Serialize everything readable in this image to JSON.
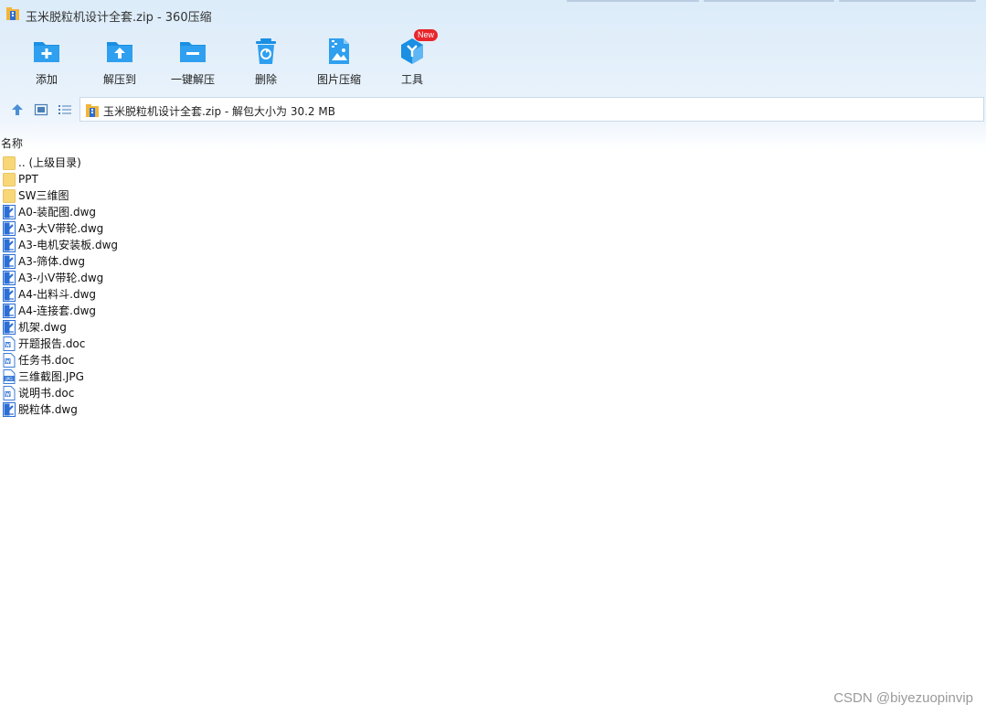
{
  "window": {
    "title": "玉米脱粒机设计全套.zip - 360压缩"
  },
  "toolbar": {
    "items": [
      {
        "label": "添加",
        "icon": "add-icon"
      },
      {
        "label": "解压到",
        "icon": "extract-to-icon"
      },
      {
        "label": "一键解压",
        "icon": "one-click-extract-icon"
      },
      {
        "label": "删除",
        "icon": "delete-icon"
      },
      {
        "label": "图片压缩",
        "icon": "image-compress-icon"
      },
      {
        "label": "工具",
        "icon": "tools-icon",
        "badge": "New"
      }
    ]
  },
  "address": {
    "text": "玉米脱粒机设计全套.zip - 解包大小为 30.2 MB"
  },
  "columns": {
    "name": "名称"
  },
  "files": [
    {
      "name": ".. (上级目录)",
      "type": "folder"
    },
    {
      "name": "PPT",
      "type": "folder"
    },
    {
      "name": "SW三维图",
      "type": "folder"
    },
    {
      "name": "A0-装配图.dwg",
      "type": "dwg"
    },
    {
      "name": "A3-大V带轮.dwg",
      "type": "dwg"
    },
    {
      "name": "A3-电机安装板.dwg",
      "type": "dwg"
    },
    {
      "name": "A3-筛体.dwg",
      "type": "dwg"
    },
    {
      "name": "A3-小V带轮.dwg",
      "type": "dwg"
    },
    {
      "name": "A4-出料斗.dwg",
      "type": "dwg"
    },
    {
      "name": "A4-连接套.dwg",
      "type": "dwg"
    },
    {
      "name": "机架.dwg",
      "type": "dwg"
    },
    {
      "name": "开题报告.doc",
      "type": "doc"
    },
    {
      "name": "任务书.doc",
      "type": "doc"
    },
    {
      "name": "三维截图.JPG",
      "type": "jpg"
    },
    {
      "name": "说明书.doc",
      "type": "doc"
    },
    {
      "name": "脱粒体.dwg",
      "type": "dwg"
    }
  ],
  "watermark": "CSDN @biyezuopinvip",
  "colors": {
    "accent": "#1a8fe3",
    "folder": "#f7d777",
    "badge": "#e8262c"
  }
}
